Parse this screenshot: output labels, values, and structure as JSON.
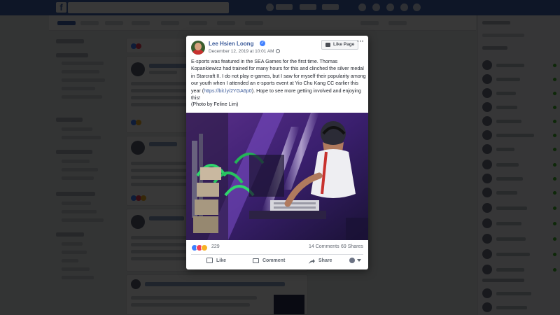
{
  "post": {
    "author": "Lee Hsien Loong",
    "date": "December 12, 2019 at 10:01 AM",
    "like_page_label": "Like Page",
    "text_before_link": "E-sports was featured in the SEA Games for the first time. Thomas Kopankiewicz had trained for many hours for this and clinched the silver medal in Starcraft II. I do not play e-games, but I saw for myself their popularity among our youth when I attended an e-sports event at Yio Chu Kang CC earlier this year (",
    "link": "https://bit.ly/2YGA6p0",
    "text_after_link": "). Hope to see more getting involved and enjoying this!",
    "credit": "(Photo by Feline Lim)",
    "reaction_count": "229",
    "comments": "14 Comments",
    "shares": "69 Shares",
    "actions": {
      "like": "Like",
      "comment": "Comment",
      "share": "Share"
    },
    "colors": {
      "link": "#385898",
      "like_reaction": "#4080ff",
      "love_reaction": "#f33e58",
      "wow_reaction": "#f7b125"
    }
  },
  "icons": {
    "verified": "verified-badge-icon",
    "privacy": "globe-icon",
    "like_page": "thumbs-up-icon",
    "more": "ellipsis-icon",
    "like": "thumbs-up-icon",
    "comment": "comment-bubble-icon",
    "share": "share-arrow-icon"
  },
  "theme": {
    "brand_blue": "#4267b2",
    "overlay": "rgba(0,0,0,0.78)"
  }
}
